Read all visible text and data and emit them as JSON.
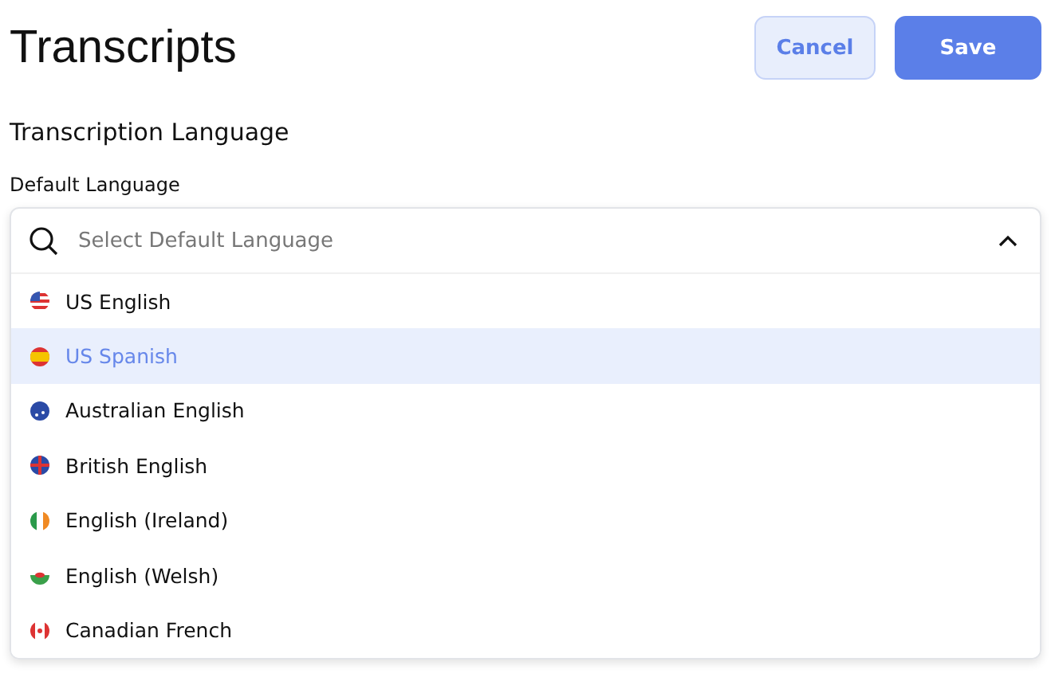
{
  "page": {
    "title": "Transcripts"
  },
  "buttons": [
    {
      "label": "Cancel",
      "kind": "secondary"
    },
    {
      "label": "Save",
      "kind": "primary"
    }
  ],
  "section": {
    "heading": "Transcription Language"
  },
  "field": {
    "label": "Default Language",
    "placeholder": "Select Default Language",
    "expanded": true
  },
  "options": [
    {
      "label": "US English",
      "kind": "us",
      "selected": false
    },
    {
      "label": "US Spanish",
      "kind": "es",
      "selected": true
    },
    {
      "label": "Australian English",
      "kind": "au",
      "selected": false
    },
    {
      "label": "British English",
      "kind": "gb",
      "selected": false
    },
    {
      "label": "English (Ireland)",
      "kind": "ie",
      "selected": false
    },
    {
      "label": "English (Welsh)",
      "kind": "wales",
      "selected": false
    },
    {
      "label": "Canadian French",
      "kind": "ca",
      "selected": false
    }
  ]
}
